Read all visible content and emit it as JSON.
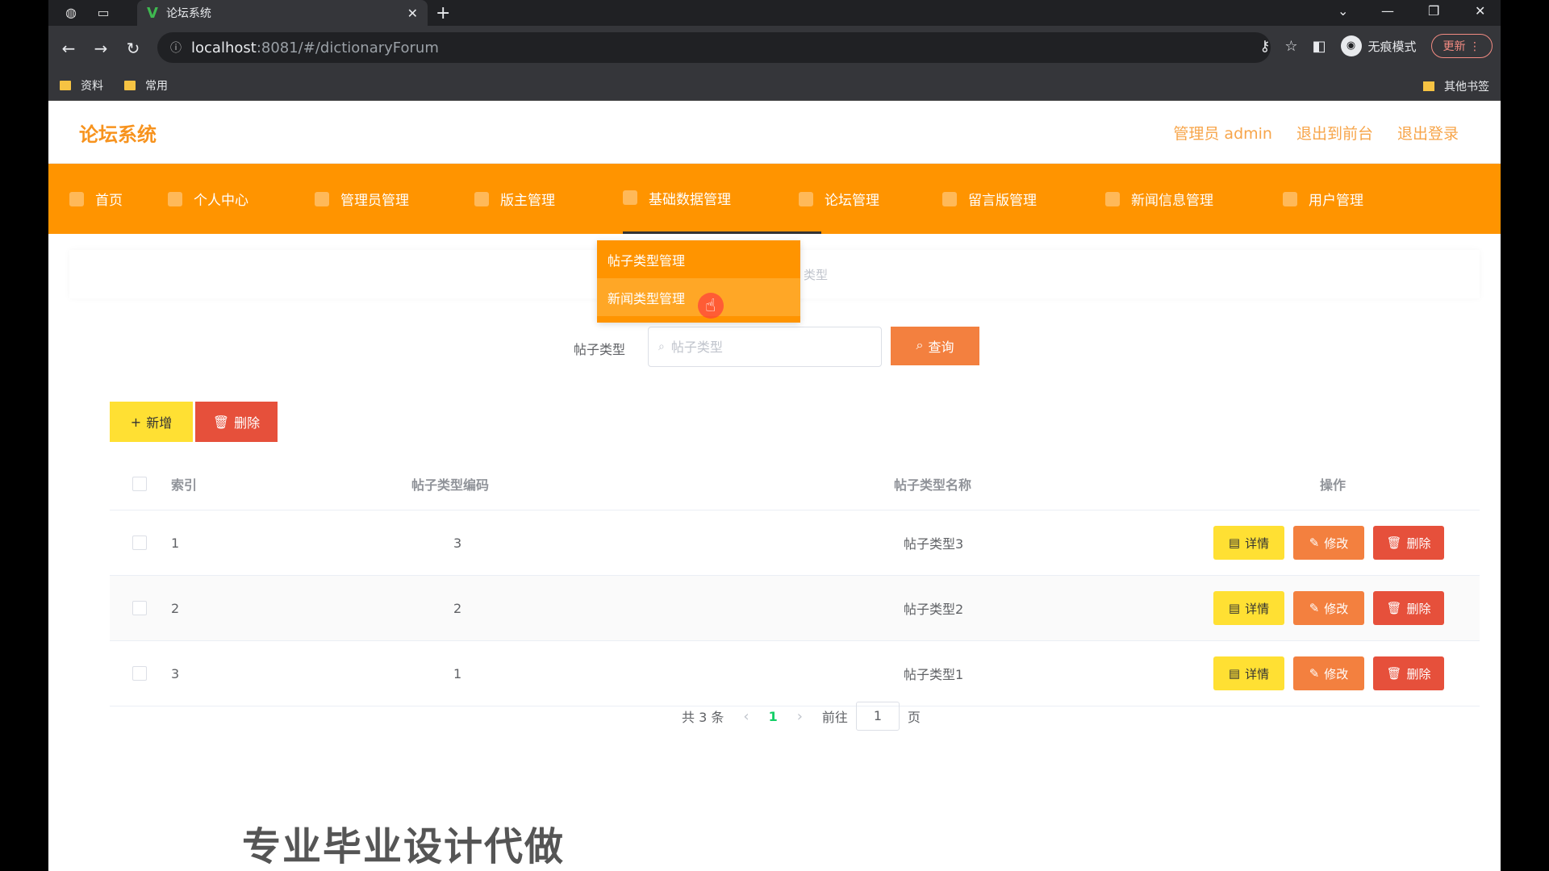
{
  "browser": {
    "tab_title": "论坛系统",
    "url_host": "localhost",
    "url_path": ":8081/#/dictionaryForum",
    "incognito_label": "无痕模式",
    "update_label": "更新",
    "bookmarks": [
      "资料",
      "常用"
    ],
    "other_bookmarks": "其他书签"
  },
  "app": {
    "title": "论坛系统",
    "header_links": [
      "管理员 admin",
      "退出到前台",
      "退出登录"
    ]
  },
  "nav": {
    "items": [
      "首页",
      "个人中心",
      "管理员管理",
      "版主管理",
      "基础数据管理",
      "论坛管理",
      "留言版管理",
      "新闻信息管理",
      "用户管理"
    ],
    "active_index": 4,
    "dropdown": [
      "帖子类型管理",
      "新闻类型管理"
    ]
  },
  "breadcrumb": "类型",
  "search": {
    "label": "帖子类型",
    "placeholder": "帖子类型",
    "button": "查询"
  },
  "actions": {
    "add": "新增",
    "delete": "删除"
  },
  "table": {
    "headers": [
      "索引",
      "帖子类型编码",
      "帖子类型名称",
      "操作"
    ],
    "rows": [
      {
        "index": "1",
        "code": "3",
        "name": "帖子类型3"
      },
      {
        "index": "2",
        "code": "2",
        "name": "帖子类型2"
      },
      {
        "index": "3",
        "code": "1",
        "name": "帖子类型1"
      }
    ],
    "op_detail": "详情",
    "op_edit": "修改",
    "op_delete": "删除"
  },
  "pager": {
    "total": "共 3 条",
    "current": "1",
    "goto_label": "前往",
    "goto_value": "1",
    "page_suffix": "页"
  },
  "watermark": "专业毕业设计代做"
}
